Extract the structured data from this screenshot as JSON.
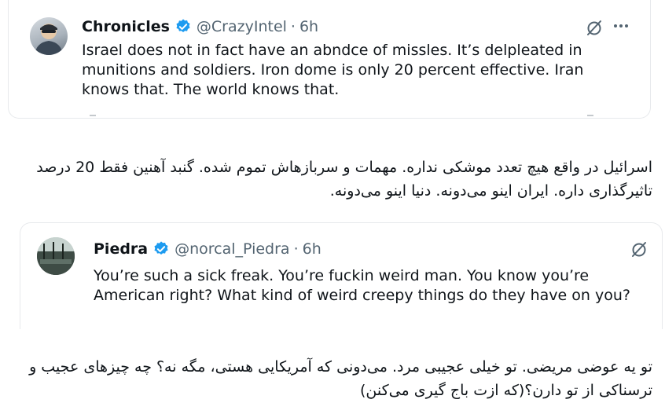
{
  "tweets": [
    {
      "display_name": "Chronicles",
      "handle": "@CrazyIntel",
      "separator": "·",
      "time": "6h",
      "text": "Israel does not in fact have an abndce of missles. It’s delpleated in munitions and soldiers. Iron dome is only 20 percent effective. Iran knows that. The world knows that.",
      "icons": [
        "avatar",
        "verified-badge-icon",
        "grok-icon",
        "more-options-icon"
      ]
    },
    {
      "display_name": "Piedra",
      "handle": "@norcal_Piedra",
      "separator": "·",
      "time": "6h",
      "text": "You’re such a sick freak. You’re fuckin weird man. You know you’re American right? What kind of weird creepy things do they have on you?",
      "icons": [
        "avatar",
        "verified-badge-icon",
        "grok-icon"
      ]
    }
  ],
  "translations": [
    "اسرائیل در واقع هیچ تعدد موشکی نداره. مهمات و سربازهاش تموم شده. گنبد آهنین فقط 20 درصد تاثیرگذاری داره. ایران اینو می‌دونه. دنیا اینو می‌دونه.",
    "تو یه عوضی مریضی. تو خیلی عجیبی مرد. می‌دونی که آمریکایی هستی، مگه نه؟ چه چیزهای عجیب و ترسناکی از تو دارن؟(که ازت باج گیری می‌کنن)"
  ],
  "colors": {
    "text": "#0f1419",
    "secondary": "#536471",
    "verified_blue": "#1d9bf0",
    "border": "#e7e9ec"
  }
}
